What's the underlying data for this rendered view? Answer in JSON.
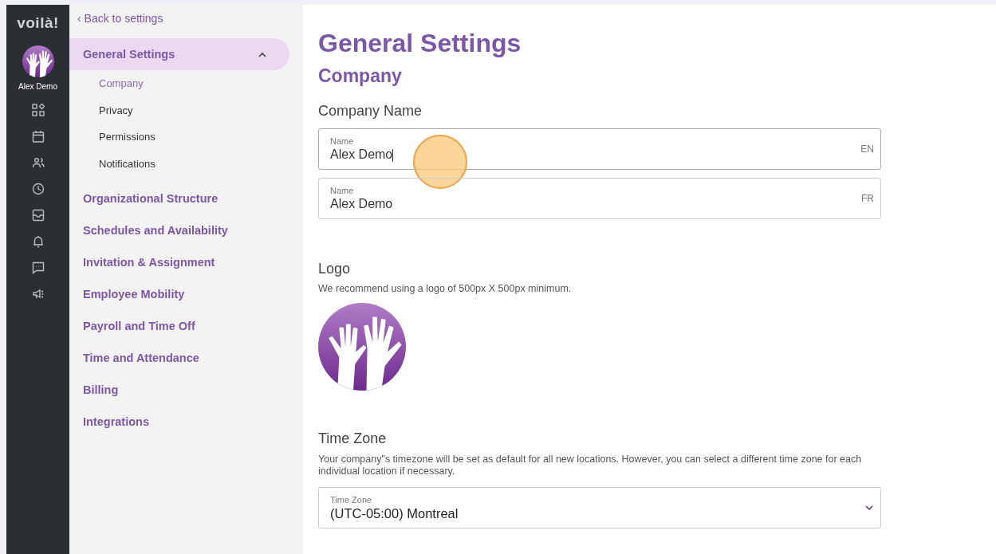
{
  "rail": {
    "brand": "voilà!",
    "user": "Alex Demo"
  },
  "sidebar": {
    "back": "‹ Back to settings",
    "sections": [
      {
        "label": "General Settings",
        "selected": true,
        "expanded": true,
        "children": [
          {
            "label": "Company",
            "selected": true
          },
          {
            "label": "Privacy",
            "selected": false
          },
          {
            "label": "Permissions",
            "selected": false
          },
          {
            "label": "Notifications",
            "selected": false
          }
        ]
      },
      {
        "label": "Organizational Structure",
        "selected": false
      },
      {
        "label": "Schedules and Availability",
        "selected": false
      },
      {
        "label": "Invitation & Assignment",
        "selected": false
      },
      {
        "label": "Employee Mobility",
        "selected": false
      },
      {
        "label": "Payroll and Time Off",
        "selected": false
      },
      {
        "label": "Time and Attendance",
        "selected": false
      },
      {
        "label": "Billing",
        "selected": false
      },
      {
        "label": "Integrations",
        "selected": false
      }
    ]
  },
  "main": {
    "title": "General Settings",
    "subtitle": "Company",
    "company_name": {
      "heading": "Company Name",
      "fields": [
        {
          "label": "Name",
          "value": "Alex Demo",
          "lang": "EN",
          "focused": true
        },
        {
          "label": "Name",
          "value": "Alex Demo",
          "lang": "FR",
          "focused": false
        }
      ]
    },
    "logo": {
      "heading": "Logo",
      "hint": "We recommend using a logo of 500px X 500px minimum."
    },
    "time_zone": {
      "heading": "Time Zone",
      "hint": "Your company\"s timezone will be set as default for all new locations. However, you can select a different time zone for each individual location if necessary.",
      "select": {
        "label": "Time Zone",
        "value": "(UTC-05:00) Montreal"
      }
    }
  }
}
